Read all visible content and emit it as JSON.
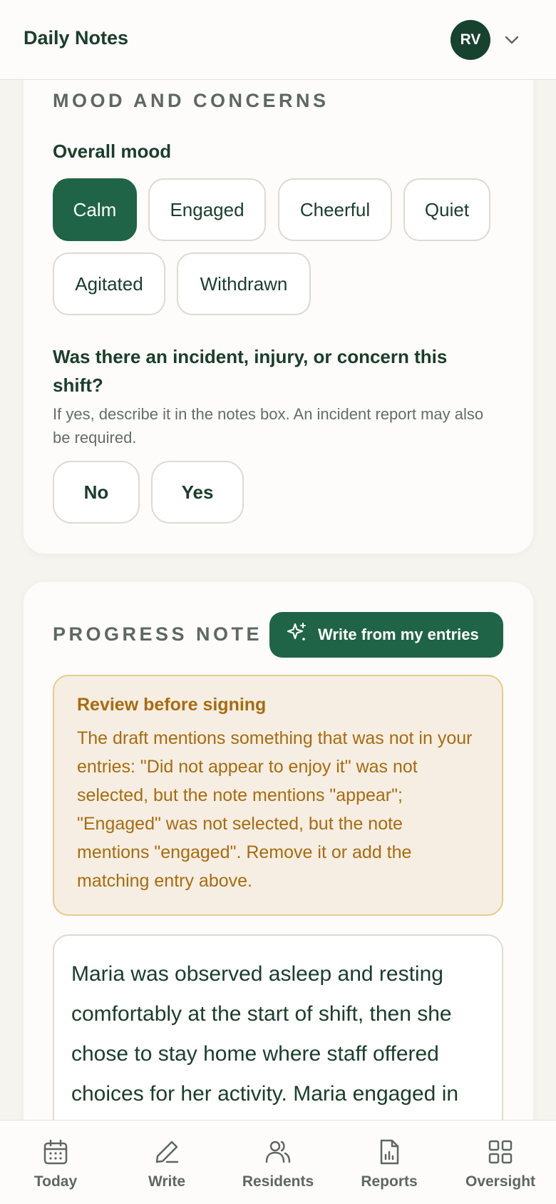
{
  "header": {
    "title": "Daily Notes",
    "avatar_initials": "RV"
  },
  "mood_section": {
    "heading": "MOOD AND CONCERNS",
    "overall_mood_label": "Overall mood",
    "mood_options": [
      {
        "label": "Calm",
        "selected": true
      },
      {
        "label": "Engaged",
        "selected": false
      },
      {
        "label": "Cheerful",
        "selected": false
      },
      {
        "label": "Quiet",
        "selected": false
      },
      {
        "label": "Agitated",
        "selected": false
      },
      {
        "label": "Withdrawn",
        "selected": false
      }
    ],
    "incident_question": "Was there an incident, injury, or concern this shift?",
    "incident_help": "If yes, describe it in the notes box. An incident report may also be required.",
    "incident_no": "No",
    "incident_yes": "Yes"
  },
  "progress_section": {
    "heading": "PROGRESS NOTE",
    "ai_button_label": "Write from my entries",
    "warning_title": "Review before signing",
    "warning_body": "The draft mentions something that was not in your entries: \"Did not appear to enjoy it\" was not selected, but the note mentions \"appear\"; \"Engaged\" was not selected, but the note mentions \"engaged\". Remove it or add the matching entry above.",
    "note_text": "Maria was observed asleep and resting comfortably at the start of shift, then she chose to stay home where staff offered choices for her activity. Maria engaged in"
  },
  "bottom_nav": {
    "items": [
      {
        "label": "Today",
        "icon": "calendar-icon"
      },
      {
        "label": "Write",
        "icon": "pencil-icon"
      },
      {
        "label": "Residents",
        "icon": "users-icon"
      },
      {
        "label": "Reports",
        "icon": "report-icon"
      },
      {
        "label": "Oversight",
        "icon": "grid-icon"
      }
    ]
  },
  "colors": {
    "primary": "#1f6446",
    "text": "#1a3d2b",
    "warning_text": "#a86b10",
    "warning_bg": "#f6eee2"
  }
}
